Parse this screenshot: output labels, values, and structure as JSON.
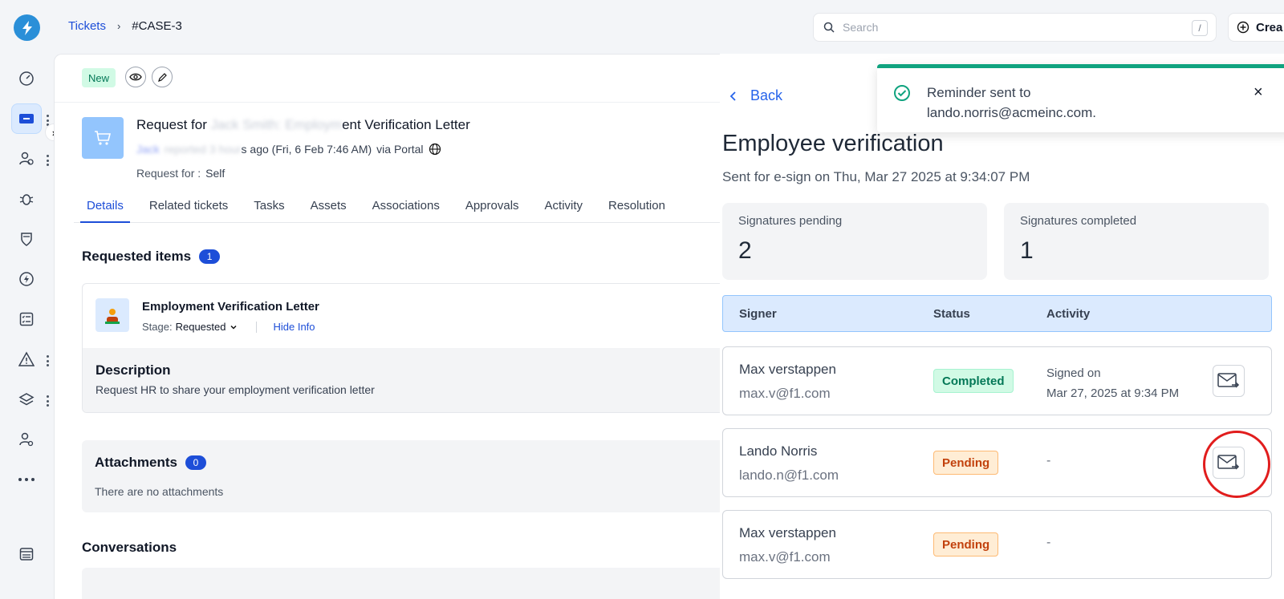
{
  "breadcrumb": {
    "root": "Tickets",
    "separator": "›",
    "current": "#CASE-3"
  },
  "search": {
    "placeholder": "Search",
    "shortcut": "/"
  },
  "create_label": "Crea",
  "rail_collapse": "›",
  "ticket": {
    "status": "New",
    "title_prefix": "Request for",
    "title_blurred": "Jack Smith: Employm",
    "title_suffix": "ent Verification Letter",
    "requester_blurred": "Jack",
    "reported_blurred": "reported 3 hour",
    "reported_suffix": "s ago (Fri, 6 Feb 7:46 AM)",
    "via": "via Portal",
    "request_for_label": "Request for :",
    "request_for_value": "Self"
  },
  "tabs": [
    "Details",
    "Related tickets",
    "Tasks",
    "Assets",
    "Associations",
    "Approvals",
    "Activity",
    "Resolution"
  ],
  "requested_items": {
    "heading": "Requested items",
    "count": "1",
    "item_name": "Employment Verification Letter",
    "stage_label": "Stage:",
    "stage_value": "Requested",
    "hide_info": "Hide Info",
    "description_title": "Description",
    "description_text": "Request HR to share your employment verification letter"
  },
  "attachments": {
    "heading": "Attachments",
    "count": "0",
    "empty": "There are no attachments"
  },
  "conversations": {
    "heading": "Conversations"
  },
  "drawer": {
    "back": "Back",
    "title": "Employee verification",
    "subtitle": "Sent for e-sign on Thu, Mar 27 2025 at 9:34:07 PM",
    "pending_label": "Signatures pending",
    "pending_value": "2",
    "completed_label": "Signatures completed",
    "completed_value": "1",
    "headers": {
      "signer": "Signer",
      "status": "Status",
      "activity": "Activity"
    },
    "rows": [
      {
        "name": "Max verstappen",
        "email": "max.v@f1.com",
        "status": "Completed",
        "activity_line1": "Signed on",
        "activity_line2": "Mar 27, 2025 at 9:34 PM"
      },
      {
        "name": "Lando Norris",
        "email": "lando.n@f1.com",
        "status": "Pending",
        "activity": "-"
      },
      {
        "name": "Max verstappen",
        "email": "max.v@f1.com",
        "status": "Pending",
        "activity": "-"
      }
    ]
  },
  "toast": {
    "message": "Reminder sent to lando.norris@acmeinc.com.",
    "close": "×"
  },
  "colors": {
    "accent": "#1d4ed8",
    "success": "#10a37f",
    "pending": "#c2410c",
    "highlight_ring": "#e11d1d"
  }
}
